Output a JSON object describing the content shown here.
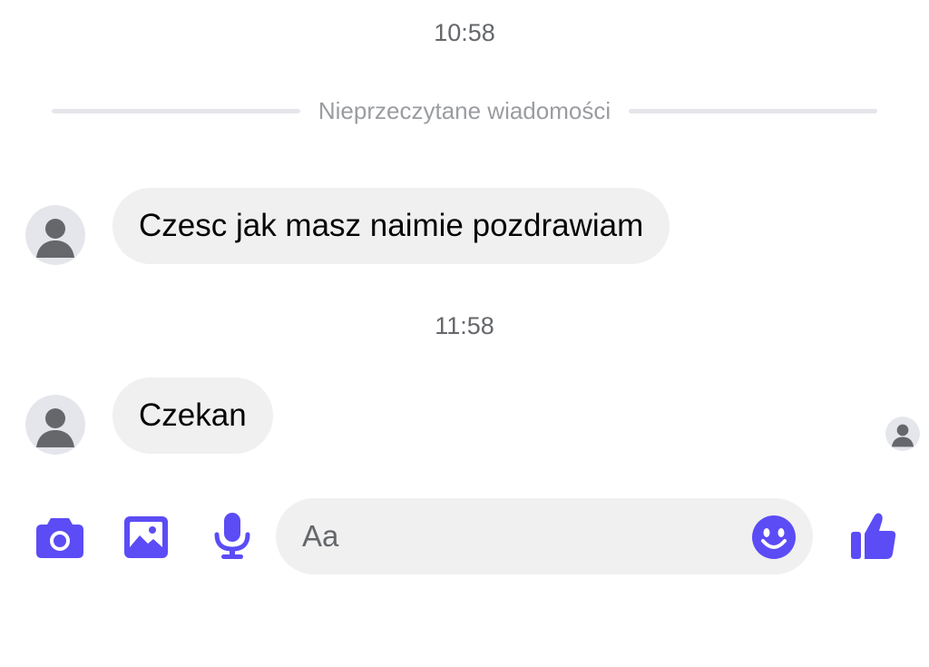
{
  "accent_color": "#5b4cf5",
  "bubble_color": "#f0f0f0",
  "conversation": {
    "timestamps": [
      "10:58",
      "11:58"
    ],
    "unread_divider_label": "Nieprzeczytane wiadomości",
    "messages": [
      {
        "sender": "contact",
        "text": "Czesc jak masz naimie pozdrawiam"
      },
      {
        "sender": "contact",
        "text": "Czekan"
      }
    ],
    "seen_indicator_icon": "avatar-placeholder-icon"
  },
  "composer": {
    "placeholder": "Aa",
    "icons": [
      "camera-icon",
      "gallery-icon",
      "microphone-icon",
      "emoji-icon",
      "thumbs-up-icon"
    ]
  }
}
